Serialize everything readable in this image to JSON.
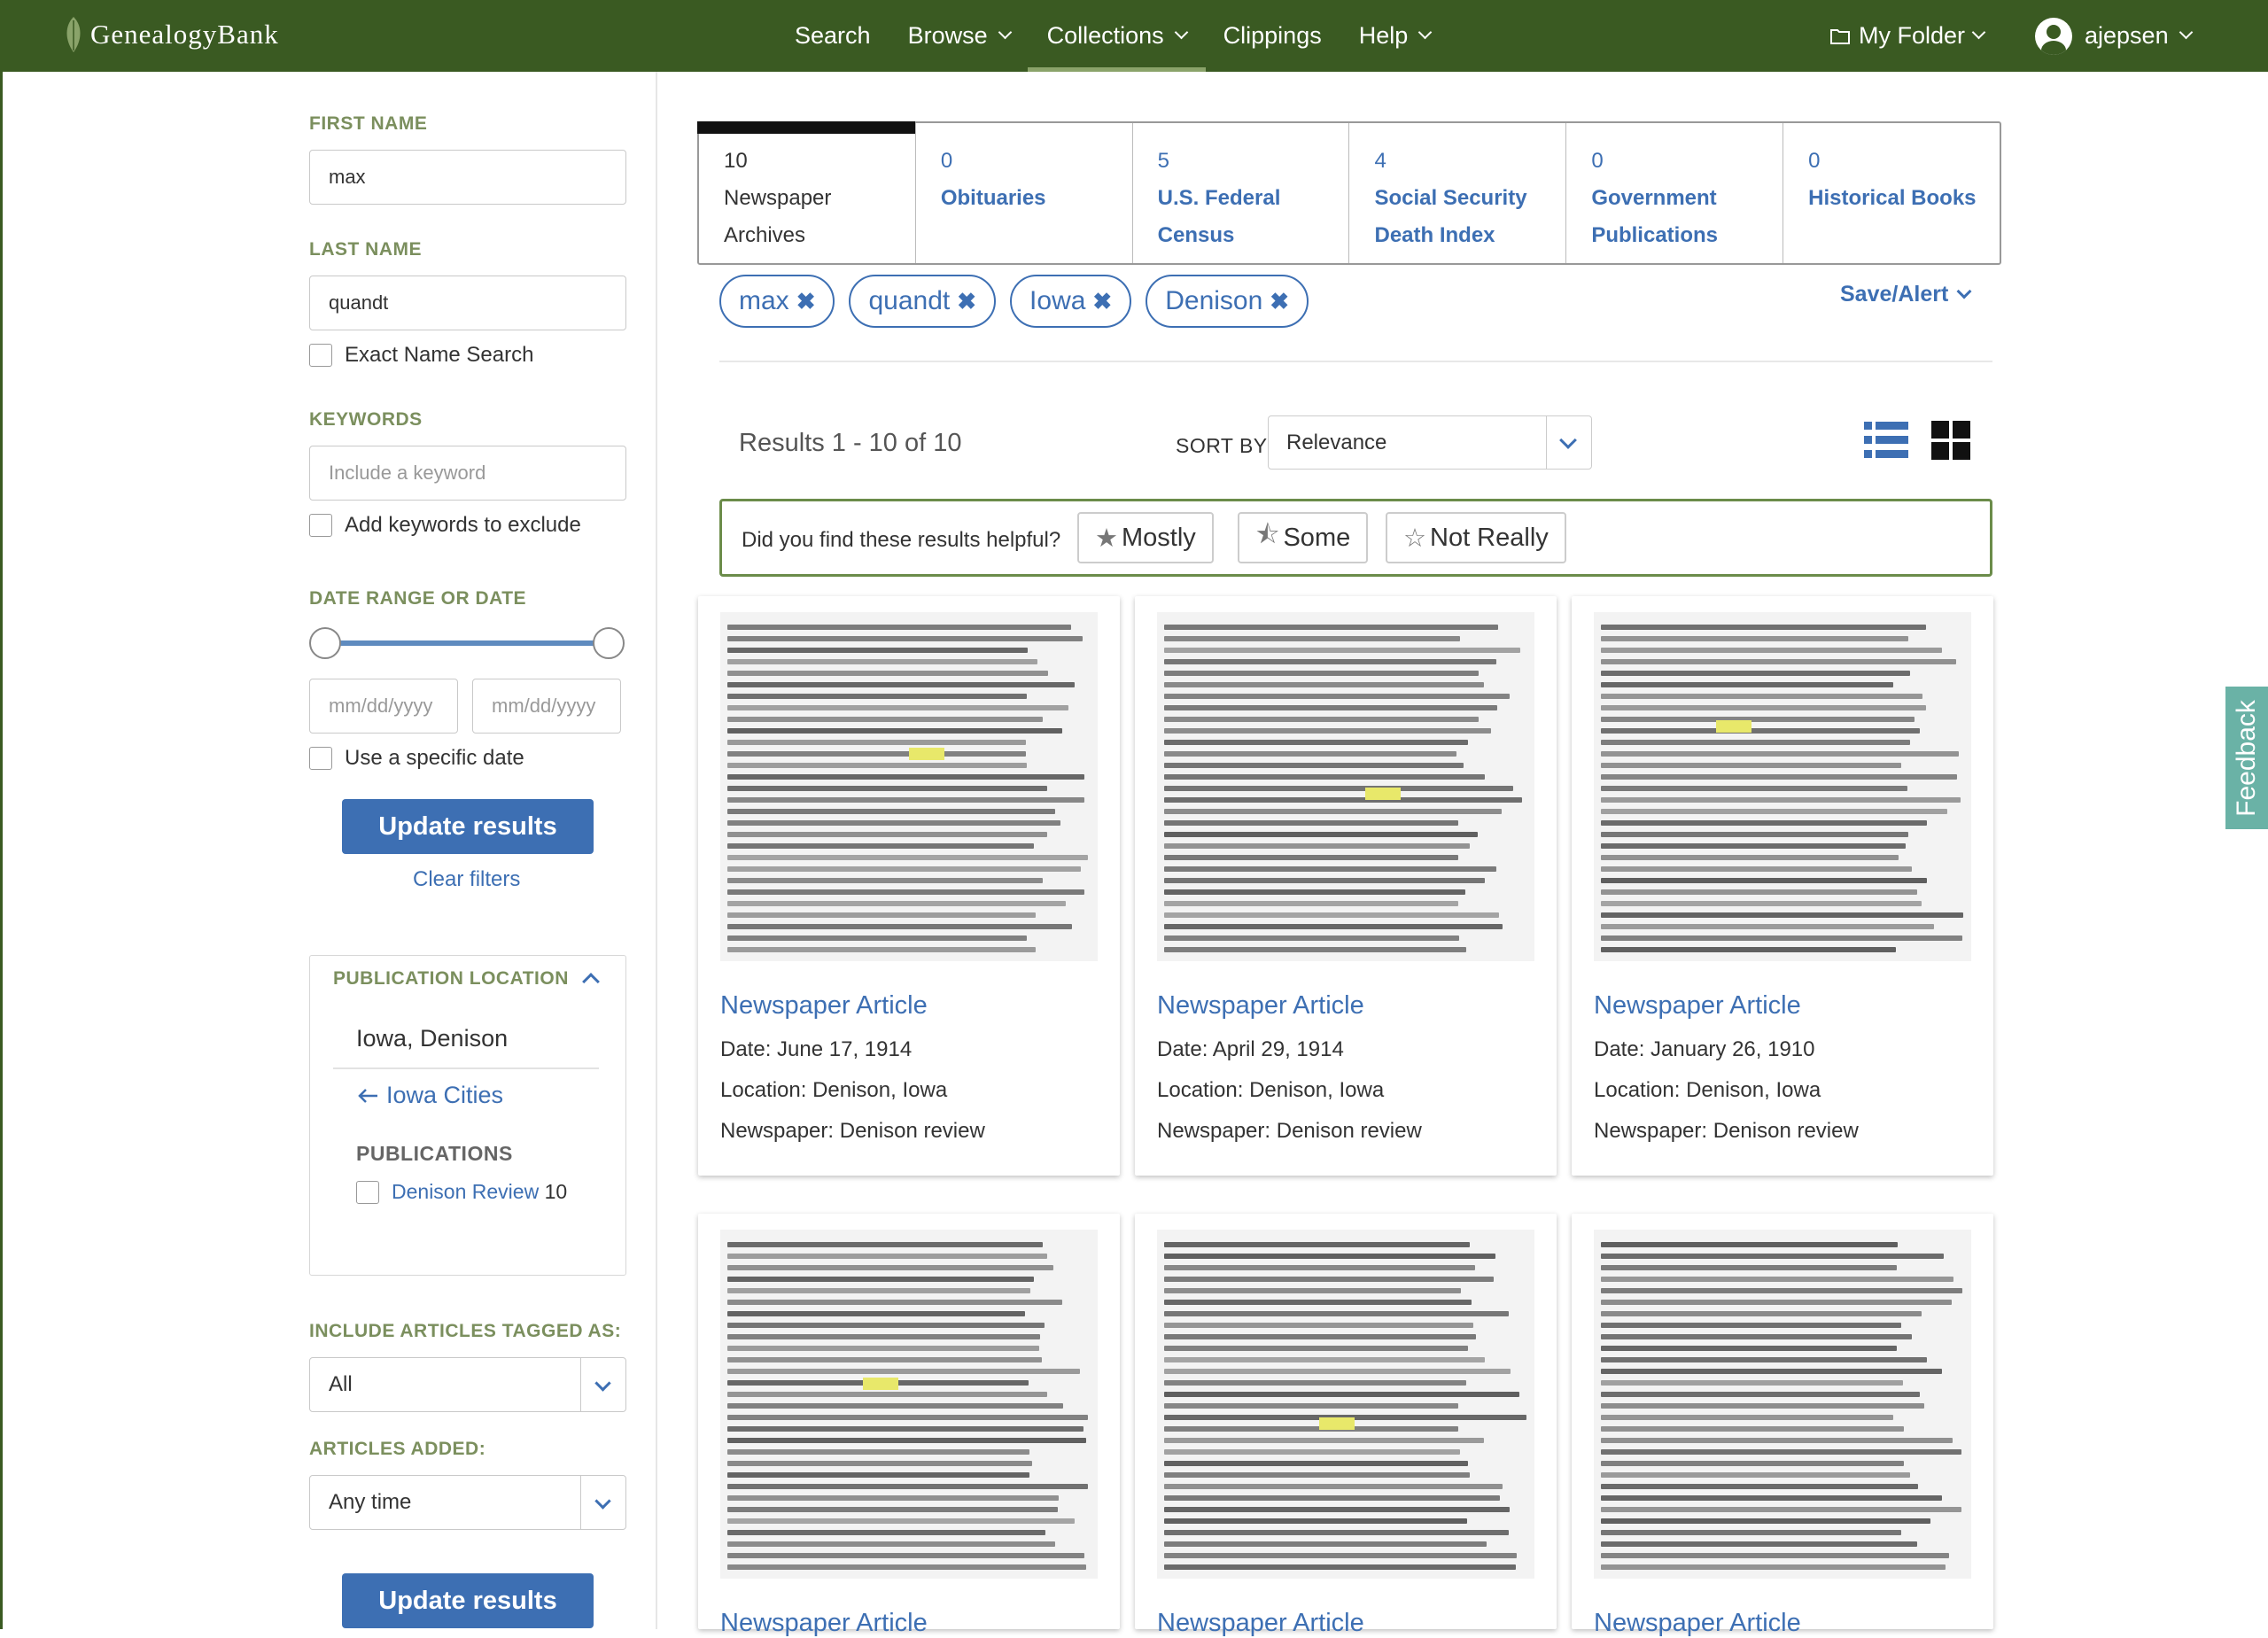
{
  "header": {
    "logo_text": "GenealogyBank",
    "nav": [
      {
        "label": "Search",
        "dropdown": false
      },
      {
        "label": "Browse",
        "dropdown": true
      },
      {
        "label": "Collections",
        "dropdown": true
      },
      {
        "label": "Clippings",
        "dropdown": false
      },
      {
        "label": "Help",
        "dropdown": true
      }
    ],
    "active_nav": "Collections",
    "folder_label": "My Folder",
    "username": "ajepsen"
  },
  "sidebar": {
    "first_name_label": "FIRST NAME",
    "first_name_value": "max",
    "last_name_label": "LAST NAME",
    "last_name_value": "quandt",
    "exact_name_label": "Exact Name Search",
    "keywords_label": "KEYWORDS",
    "keyword_placeholder": "Include a keyword",
    "exclude_label": "Add keywords to exclude",
    "date_label": "DATE RANGE OR DATE",
    "date_from_placeholder": "mm/dd/yyyy",
    "date_to_placeholder": "mm/dd/yyyy",
    "specific_date_label": "Use a specific date",
    "update_label": "Update results",
    "clear_label": "Clear filters",
    "pub_location_label": "PUBLICATION LOCATION",
    "location_value": "Iowa, Denison",
    "back_link": "Iowa Cities",
    "publications_label": "PUBLICATIONS",
    "publication_name": "Denison Review",
    "publication_count": "10",
    "tagged_label": "INCLUDE ARTICLES TAGGED AS:",
    "tagged_value": "All",
    "added_label": "ARTICLES ADDED:",
    "added_value": "Any time",
    "update_label2": "Update results"
  },
  "tabs": [
    {
      "count": "10",
      "line1": "Newspaper",
      "line2": "Archives"
    },
    {
      "count": "0",
      "line1": "Obituaries",
      "line2": ""
    },
    {
      "count": "5",
      "line1": "U.S. Federal",
      "line2": "Census"
    },
    {
      "count": "4",
      "line1": "Social Security",
      "line2": "Death Index"
    },
    {
      "count": "0",
      "line1": "Government",
      "line2": "Publications"
    },
    {
      "count": "0",
      "line1": "Historical Books",
      "line2": ""
    }
  ],
  "chips": [
    "max",
    "quandt",
    "Iowa",
    "Denison"
  ],
  "save_alert": "Save/Alert",
  "results": {
    "count_text": "Results 1 - 10 of 10",
    "sort_label": "SORT BY",
    "sort_value": "Relevance"
  },
  "helpful": {
    "question": "Did you find these results helpful?",
    "mostly": "Mostly",
    "some": "Some",
    "not_really": "Not Really"
  },
  "cards": [
    {
      "title": "Newspaper Article",
      "date": "Date: June 17, 1914",
      "location": "Location: Denison, Iowa",
      "newspaper": "Newspaper: Denison review"
    },
    {
      "title": "Newspaper Article",
      "date": "Date: April 29, 1914",
      "location": "Location: Denison, Iowa",
      "newspaper": "Newspaper: Denison review"
    },
    {
      "title": "Newspaper Article",
      "date": "Date: January 26, 1910",
      "location": "Location: Denison, Iowa",
      "newspaper": "Newspaper: Denison review"
    },
    {
      "title": "Newspaper Article"
    },
    {
      "title": "Newspaper Article"
    },
    {
      "title": "Newspaper Article"
    }
  ],
  "feedback_label": "Feedback",
  "colors": {
    "header_green": "#3a5a22",
    "link_blue": "#3d6fb3",
    "label_green": "#7b8f5e",
    "feedback_teal": "#6ab2a6"
  }
}
